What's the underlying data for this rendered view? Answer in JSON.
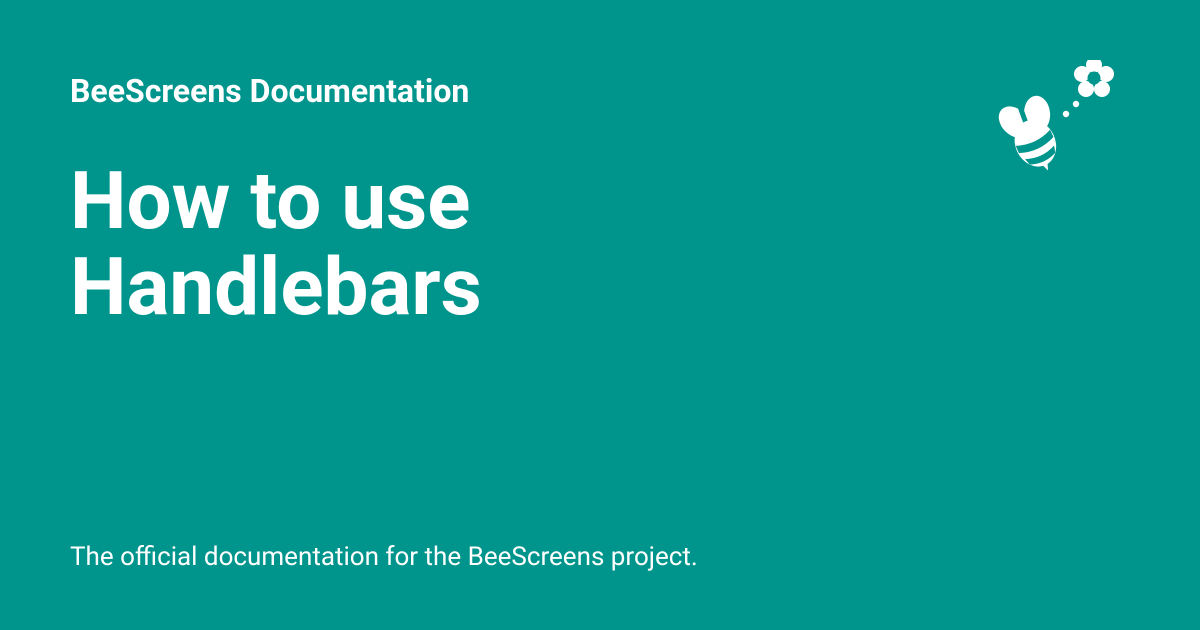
{
  "site_title": "BeeScreens Documentation",
  "page_title": "How to use Handlebars",
  "tagline": "The official documentation for the BeeScreens project.",
  "colors": {
    "background": "#00958c",
    "text": "#ffffff"
  },
  "logo": {
    "name": "bee-flower-icon"
  }
}
